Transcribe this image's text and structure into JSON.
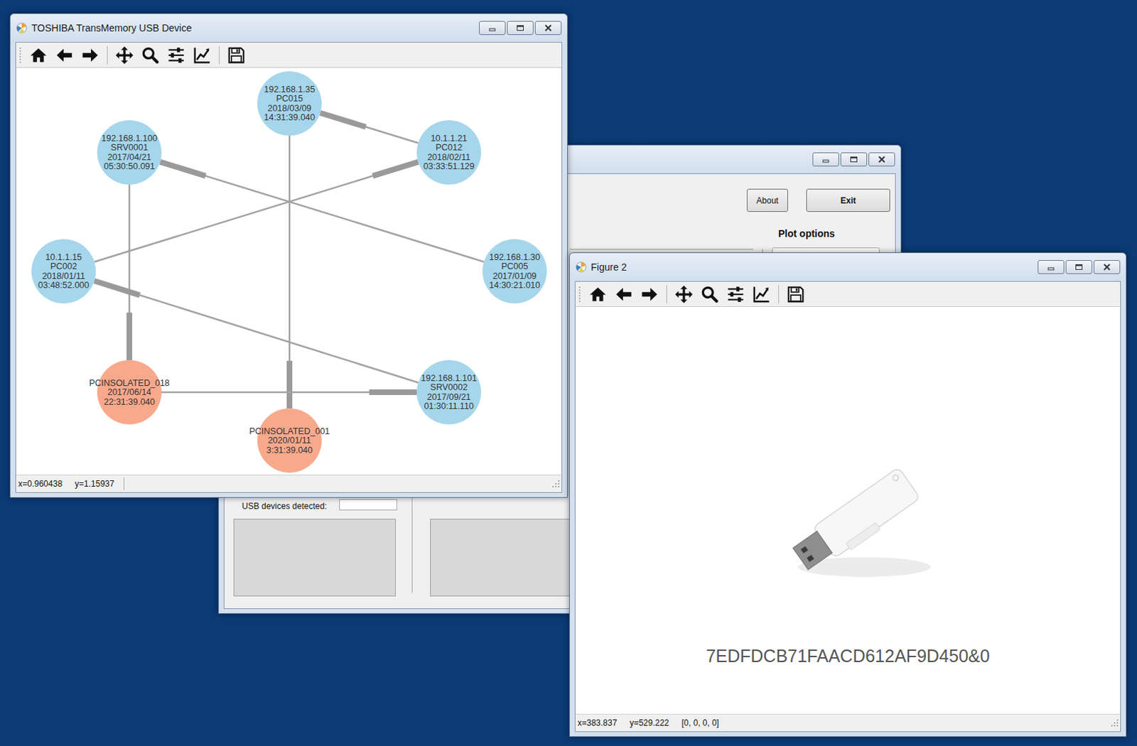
{
  "main_window": {
    "buttons": [
      "About",
      "Exit"
    ],
    "plot_options_label": "Plot options",
    "usb_devices_label": "USB devices detected:"
  },
  "graph_window": {
    "title": "TOSHIBA TransMemory USB Device",
    "nodes": [
      {
        "lines": [
          "192.168.1.35",
          "PC015",
          "2018/03/09",
          "14:31:39.040"
        ],
        "color": "#a6d6ec"
      },
      {
        "lines": [
          "192.168.1.100",
          "SRV0001",
          "2017/04/21",
          "05:30:50.091"
        ],
        "color": "#a6d6ec"
      },
      {
        "lines": [
          "10.1.1.21",
          "PC012",
          "2018/02/11",
          "03:33:51.129"
        ],
        "color": "#a6d6ec"
      },
      {
        "lines": [
          "10.1.1.15",
          "PC002",
          "2018/01/11",
          "03:48:52.000"
        ],
        "color": "#a6d6ec"
      },
      {
        "lines": [
          "192.168.1.30",
          "PC005",
          "2017/01/09",
          "14:30:21.010"
        ],
        "color": "#a6d6ec"
      },
      {
        "lines": [
          "PCINSOLATED_018",
          "2017/06/14",
          "22:31:39.040"
        ],
        "color": "#f8a98c"
      },
      {
        "lines": [
          "192.168.1.101",
          "SRV0002",
          "2017/09/21",
          "01:30:11.110"
        ],
        "color": "#a6d6ec"
      },
      {
        "lines": [
          "PCINSOLATED_001",
          "2020/01/11",
          "3:31:39.040"
        ],
        "color": "#f8a98c"
      }
    ],
    "edges": [
      {
        "from": 2,
        "to": 0
      },
      {
        "from": 4,
        "to": 1
      },
      {
        "from": 3,
        "to": 2
      },
      {
        "from": 0,
        "to": 7
      },
      {
        "from": 1,
        "to": 5
      },
      {
        "from": 6,
        "to": 3
      },
      {
        "from": 5,
        "to": 6
      }
    ],
    "status_bar": {
      "x": "x=0.960438",
      "y": "y=1.15937"
    }
  },
  "figure_window": {
    "title": "Figure 2",
    "label": "7EDFDCB71FAACD612AF9D450&0",
    "status_bar": {
      "x": "x=383.837",
      "y": "y=529.222",
      "value": "[0, 0, 0, 0]"
    }
  }
}
